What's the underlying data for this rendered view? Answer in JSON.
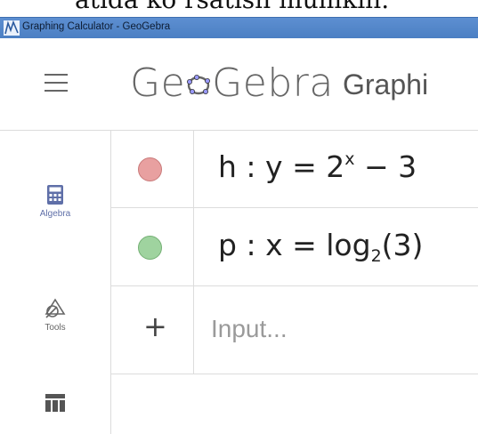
{
  "window": {
    "title": "Graphing Calculator - GeoGebra",
    "above_text_fragment": "atida ko rsatish mumkin."
  },
  "header": {
    "logo_text_left": "Ge",
    "logo_text_right": "Gebra",
    "app_name": "Graphi"
  },
  "sidebar": {
    "items": [
      {
        "label": "Algebra",
        "icon": "calculator-icon"
      },
      {
        "label": "Tools",
        "icon": "tools-shapes-icon"
      },
      {
        "label": "",
        "icon": "table-icon"
      }
    ]
  },
  "algebra": {
    "rows": [
      {
        "name": "h",
        "colon": ":",
        "lhs": "y",
        "eq": "=",
        "base": "2",
        "exp": "x",
        "tail": "− 3",
        "color": "#e8a0a0",
        "border": "#c97a7a"
      },
      {
        "name": "p",
        "colon": ":",
        "lhs": "x",
        "eq": "=",
        "func": "log",
        "sub": "2",
        "arg": "(3)",
        "color": "#9fd39f",
        "border": "#74b074"
      }
    ],
    "input": {
      "plus": "+",
      "placeholder": "Input..."
    }
  },
  "colors": {
    "titlebar": "#5d8fd1",
    "algebra_accent": "#5f6fa8"
  }
}
